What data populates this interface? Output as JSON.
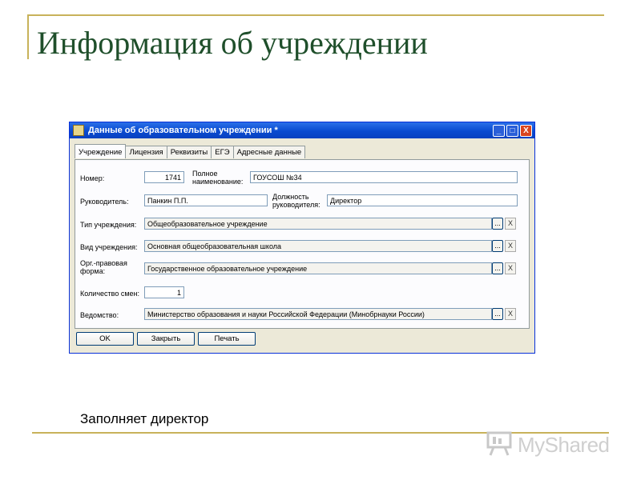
{
  "slide": {
    "title": "Информация об учреждении",
    "caption": "Заполняет директор",
    "logo_text": "MyShared"
  },
  "window": {
    "title": "Данные об образовательном учреждении *",
    "controls": {
      "minimize": "_",
      "maximize": "□",
      "close": "X"
    }
  },
  "tabs": [
    {
      "label": "Учреждение",
      "active": true
    },
    {
      "label": "Лицензия",
      "active": false
    },
    {
      "label": "Реквизиты",
      "active": false
    },
    {
      "label": "ЕГЭ",
      "active": false
    },
    {
      "label": "Адресные данные",
      "active": false
    }
  ],
  "form": {
    "number": {
      "label": "Номер:",
      "value": "1741"
    },
    "full_name": {
      "label": "Полное наименование:",
      "value": "ГОУСОШ №34"
    },
    "director": {
      "label": "Руководитель:",
      "value": "Панкин П.П."
    },
    "director_position": {
      "label": "Должность руководителя:",
      "value": "Директор"
    },
    "institution_type": {
      "label": "Тип учреждения:",
      "value": "Общеобразовательное учреждение"
    },
    "institution_kind": {
      "label": "Вид учреждения:",
      "value": "Основная общеобразовательная школа"
    },
    "legal_form": {
      "label": "Орг.-правовая форма:",
      "value": "Государственное образовательное учреждение"
    },
    "shifts": {
      "label": "Количество смен:",
      "value": "1"
    },
    "department": {
      "label": "Ведомство:",
      "value": "Министерство образования и науки Российской Федерации (Минобрнауки России)"
    },
    "select_button": "...",
    "clear_button": "X"
  },
  "buttons": {
    "ok": "OK",
    "close": "Закрыть",
    "print": "Печать"
  }
}
